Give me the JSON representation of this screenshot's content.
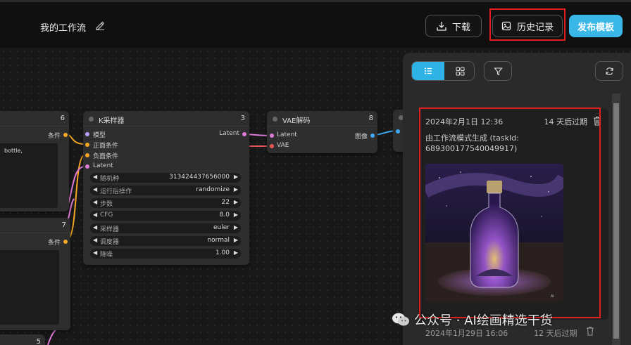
{
  "header": {
    "workflow_name": "我的工作流",
    "download_label": "下载",
    "history_label": "历史记录",
    "publish_label": "发布模板"
  },
  "colors": {
    "accent": "#39b8e8",
    "highlight": "#e02020"
  },
  "nodes": {
    "left_top": {
      "id": "6",
      "out_label": "条件",
      "text_snippet": "bottle,"
    },
    "left_mid": {
      "id": "7",
      "out_label": "条件"
    },
    "left_bottom": {
      "id": "5"
    },
    "ksampler": {
      "title": "K采样器",
      "id": "3",
      "inputs": [
        "模型",
        "正面条件",
        "负面条件",
        "Latent"
      ],
      "output": "Latent",
      "widgets": [
        {
          "label": "随机种",
          "value": "313424437656000"
        },
        {
          "label": "运行后操作",
          "value": "randomize"
        },
        {
          "label": "步数",
          "value": "22"
        },
        {
          "label": "CFG",
          "value": "8.0"
        },
        {
          "label": "采样器",
          "value": "euler"
        },
        {
          "label": "调度器",
          "value": "normal"
        },
        {
          "label": "降噪",
          "value": "1.00"
        }
      ]
    },
    "vae_decode": {
      "title": "VAE解码",
      "id": "8",
      "inputs": [
        "Latent",
        "VAE"
      ],
      "output": "图像"
    }
  },
  "history_panel": {
    "cards": [
      {
        "date": "2024年2月1日 12:36",
        "expiry": "14 天后过期",
        "description": "由工作流模式生成 (taskId: 689300177540049917)",
        "image_alt": "galaxy bottle"
      },
      {
        "date": "2024年1月29日 16:06",
        "expiry": "12 天后过期"
      }
    ]
  },
  "watermark": "公众号 · AI绘画精选干货"
}
